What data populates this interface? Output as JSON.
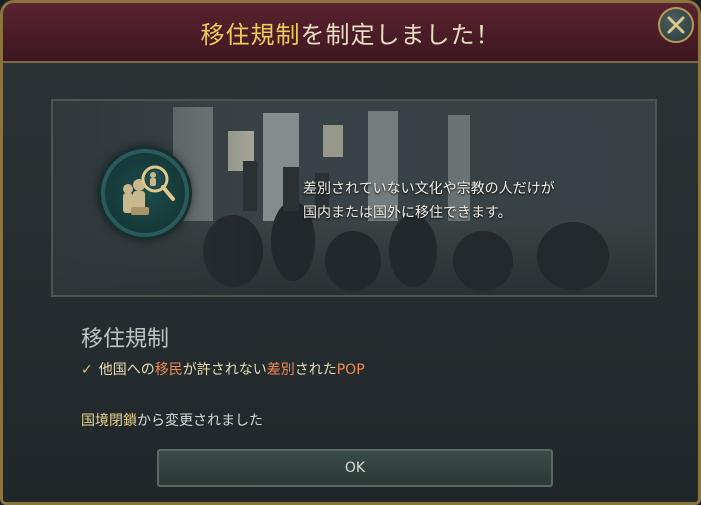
{
  "dialog": {
    "title_highlight": "移住規制",
    "title_rest": "を制定しました！",
    "close_icon": "close-icon",
    "banner_text_line1": "差別されていない文化や宗教の人だけが",
    "banner_text_line2": "国内または国外に移住できます。",
    "medallion_icon": "migrant-magnifier-icon",
    "section_title": "移住規制",
    "effect": {
      "check_mark": "✓",
      "part1": "他国への",
      "part2": "移民",
      "part3": "が許されない",
      "part4": "差別",
      "part5": "された",
      "part6": "POP"
    },
    "change": {
      "previous": "国境閉鎖",
      "suffix": "から変更されました"
    },
    "ok_label": "OK"
  },
  "colors": {
    "title_bar": "#4a1c27",
    "frame_gold": "#8c7440",
    "accent_orange": "#f08a55",
    "panel_bg": "#262d30"
  }
}
